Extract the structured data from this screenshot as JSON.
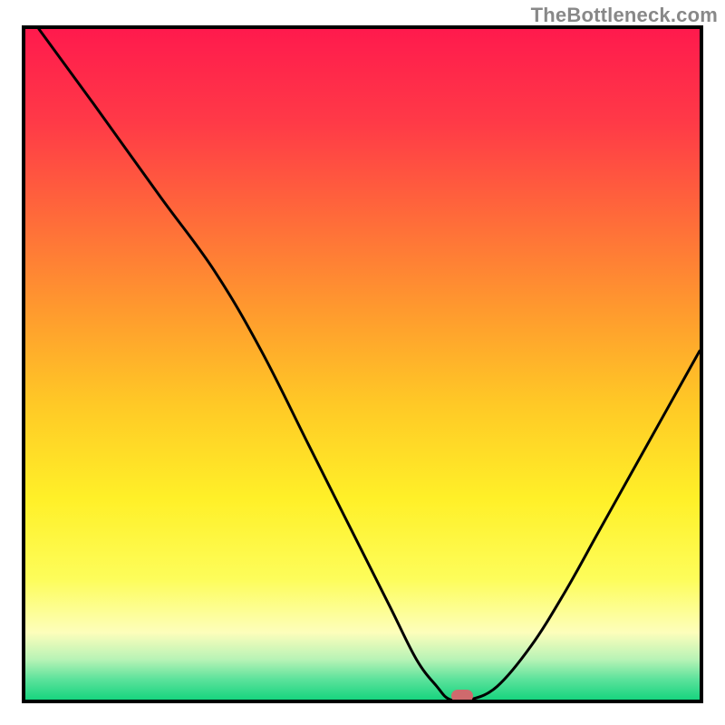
{
  "watermark": "TheBottleneck.com",
  "chart_data": {
    "type": "line",
    "title": "",
    "xlabel": "",
    "ylabel": "",
    "xlim": [
      0,
      100
    ],
    "ylim": [
      0,
      100
    ],
    "x": [
      2,
      10,
      20,
      28,
      35,
      42,
      48,
      54,
      58,
      61,
      63,
      66,
      70,
      75,
      80,
      85,
      90,
      95,
      100
    ],
    "values": [
      100,
      89,
      75,
      64,
      52,
      38,
      26,
      14,
      6,
      2,
      0,
      0,
      2,
      8,
      16,
      25,
      34,
      43,
      52
    ],
    "marker": {
      "x": 64.8,
      "y": 0.6
    },
    "gradient_stops": [
      {
        "offset": 0.0,
        "color": "#ff1a4d"
      },
      {
        "offset": 0.14,
        "color": "#ff3a47"
      },
      {
        "offset": 0.28,
        "color": "#ff6a3a"
      },
      {
        "offset": 0.42,
        "color": "#ff9a2e"
      },
      {
        "offset": 0.56,
        "color": "#ffc926"
      },
      {
        "offset": 0.7,
        "color": "#fff028"
      },
      {
        "offset": 0.82,
        "color": "#fdfd5a"
      },
      {
        "offset": 0.9,
        "color": "#fdfebb"
      },
      {
        "offset": 0.94,
        "color": "#b8f3b6"
      },
      {
        "offset": 0.97,
        "color": "#5be29b"
      },
      {
        "offset": 1.0,
        "color": "#17d47f"
      }
    ]
  }
}
